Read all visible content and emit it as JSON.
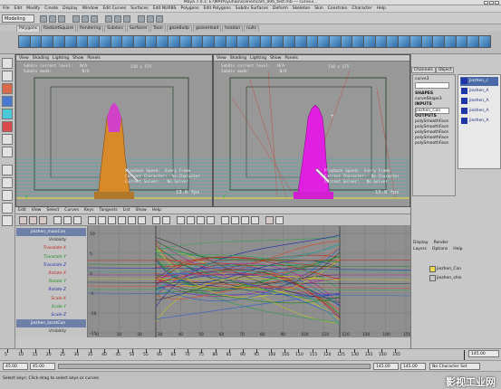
{
  "window": {
    "title": "Maya 7.0.1: E:\\MAYA\\yuhao\\scenes\\cam_006_test.mb  ---  curve3..."
  },
  "menubar": [
    "File",
    "Edit",
    "Modify",
    "Create",
    "Display",
    "Window",
    "Edit Curves",
    "Surfaces",
    "Edit NURBS",
    "Polygons",
    "Edit Polygons",
    "Subdiv Surfaces",
    "Deform",
    "Skeleton",
    "Skin",
    "Constrain",
    "Character",
    "Help"
  ],
  "mode_selector": "Modeling",
  "shelf_tabs": [
    "Polygons",
    "RadiantSquare",
    "Rendering",
    "Subdivs",
    "Surfaces",
    "Toon",
    "gezeBodp",
    "gezeeHead",
    "headan",
    "nulls"
  ],
  "viewport_left": {
    "menu": [
      "View",
      "Shading",
      "Lighting",
      "Show",
      "Panels"
    ],
    "hud_top": [
      "Subdiv current level:   N/A",
      "Subdiv mode:             N/A"
    ],
    "hud_top_right": "110 x 575",
    "hud_bottom": [
      "Playback Speed:  Every Frame",
      "Current Character:  No Character",
      "Current Solver:   No Solver"
    ],
    "fps": "13.8 fps"
  },
  "viewport_right": {
    "menu": [
      "View",
      "Shading",
      "Lighting",
      "Show",
      "Panels"
    ],
    "hud_top": [
      "Subdiv current level:   N/A",
      "Subdiv mode:             N/A"
    ],
    "hud_top_right": "110 x 575",
    "hud_bottom": [
      "Playback Speed:  Every Frame",
      "Current Character:  No Character",
      "Current Solver:   No Solver"
    ],
    "fps": "13.8 fps"
  },
  "graph_editor": {
    "menu": [
      "Edit",
      "View",
      "Select",
      "Curves",
      "Keys",
      "Tangents",
      "List",
      "Show",
      "Help"
    ],
    "outliner_rows": [
      {
        "type": "node",
        "label": "jiezhen_mainCon"
      },
      {
        "type": "attr",
        "label": "Visibility",
        "color": "#222222"
      },
      {
        "type": "attr",
        "label": "Translate X",
        "color": "#c0201a"
      },
      {
        "type": "attr",
        "label": "Translate Y",
        "color": "#1a8a1a"
      },
      {
        "type": "attr",
        "label": "Translate Z",
        "color": "#1a2aa8"
      },
      {
        "type": "attr",
        "label": "Rotate X",
        "color": "#c0201a"
      },
      {
        "type": "attr",
        "label": "Rotate Y",
        "color": "#1a8a1a"
      },
      {
        "type": "attr",
        "label": "Rotate Z",
        "color": "#1a2aa8"
      },
      {
        "type": "attr",
        "label": "Scale X",
        "color": "#c0201a"
      },
      {
        "type": "attr",
        "label": "Scale Y",
        "color": "#1a8a1a"
      },
      {
        "type": "attr",
        "label": "Scale Z",
        "color": "#1a2aa8"
      },
      {
        "type": "node",
        "label": "jiezhen_locatCon"
      },
      {
        "type": "attr",
        "label": "Visibility",
        "color": "#222222"
      }
    ],
    "y_labels": [
      "10",
      "5",
      "0",
      "-5",
      "-10",
      "-15"
    ],
    "x_labels": [
      "0",
      "10",
      "20",
      "30",
      "40",
      "50",
      "60",
      "70",
      "80",
      "90",
      "100",
      "110",
      "120",
      "130",
      "140",
      "150"
    ]
  },
  "channel_box": {
    "tabs": [
      "Channels",
      "Object"
    ],
    "object": "curve3",
    "shapes_header": "SHAPES",
    "shape": "curveShape3",
    "inputs_header": "INPUTS",
    "input": "jiezhen_Con",
    "outputs_header": "OUTPUTS",
    "outputs": [
      "polySmoothFace",
      "polySmoothFace",
      "polySmoothFace",
      "polySmoothFace",
      "polySmoothFace"
    ]
  },
  "icon_list": [
    "jiezhen_c",
    "jiezhen_A",
    "jiezhen_A",
    "jiezhen_A",
    "jiezhen_A"
  ],
  "layers": {
    "tabs": [
      "Display",
      "Render"
    ],
    "menu": [
      "Layers",
      "Options",
      "Help"
    ],
    "rows": [
      {
        "label": "jiezhen_Con",
        "color": "#e8d84a"
      },
      {
        "label": "jiezhen_shin",
        "color": "#c8c8c8"
      }
    ]
  },
  "time_slider": {
    "labels": [
      "5",
      "10",
      "15",
      "20",
      "25",
      "30",
      "35",
      "40",
      "45",
      "50",
      "55",
      "60",
      "65",
      "70",
      "75",
      "80",
      "85",
      "90",
      "95",
      "100",
      "105",
      "110",
      "115",
      "120",
      "125",
      "130",
      "135",
      "140",
      "145"
    ],
    "current_frame": "145.00"
  },
  "range": {
    "start": "45.00",
    "inner_start": "45.00",
    "inner_end": "145.00",
    "end": "145.00",
    "character_set": "No Character Set"
  },
  "help_line": "Select keys: Click-drag to select keys or curves",
  "watermark": "影视工业网"
}
